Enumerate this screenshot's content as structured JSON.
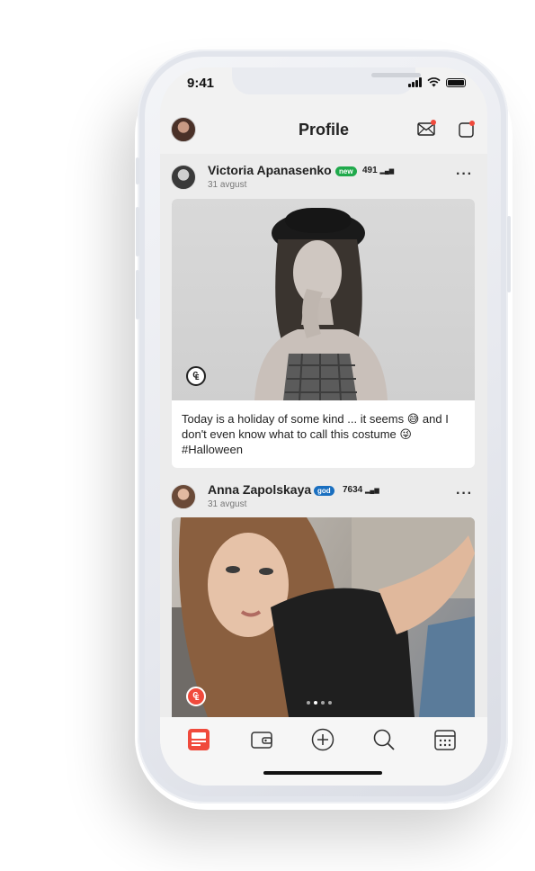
{
  "status_bar": {
    "time": "9:41"
  },
  "header": {
    "title": "Profile"
  },
  "posts": [
    {
      "author": "Victoria Apanasenko",
      "badge": "new",
      "badge_color": "#1fa94b",
      "score": "491",
      "date": "31 avgust",
      "caption": "Today is a holiday of some kind ... it seems 😅 and I don't even know what to call this costume 😜 #Halloween",
      "coin_icon": "coin-icon"
    },
    {
      "author": "Anna Zapolskaya",
      "badge": "god",
      "badge_color": "#1a6fc0",
      "score": "7634",
      "date": "31 avgust",
      "carousel": {
        "count": 4,
        "active": 1
      },
      "coin_icon": "coin-icon"
    }
  ],
  "tabbar": {
    "items": [
      "feed-icon",
      "wallet-icon",
      "add-icon",
      "search-icon",
      "calendar-icon"
    ],
    "active": 0
  },
  "colors": {
    "accent": "#f04a3c",
    "background": "#ececec"
  }
}
